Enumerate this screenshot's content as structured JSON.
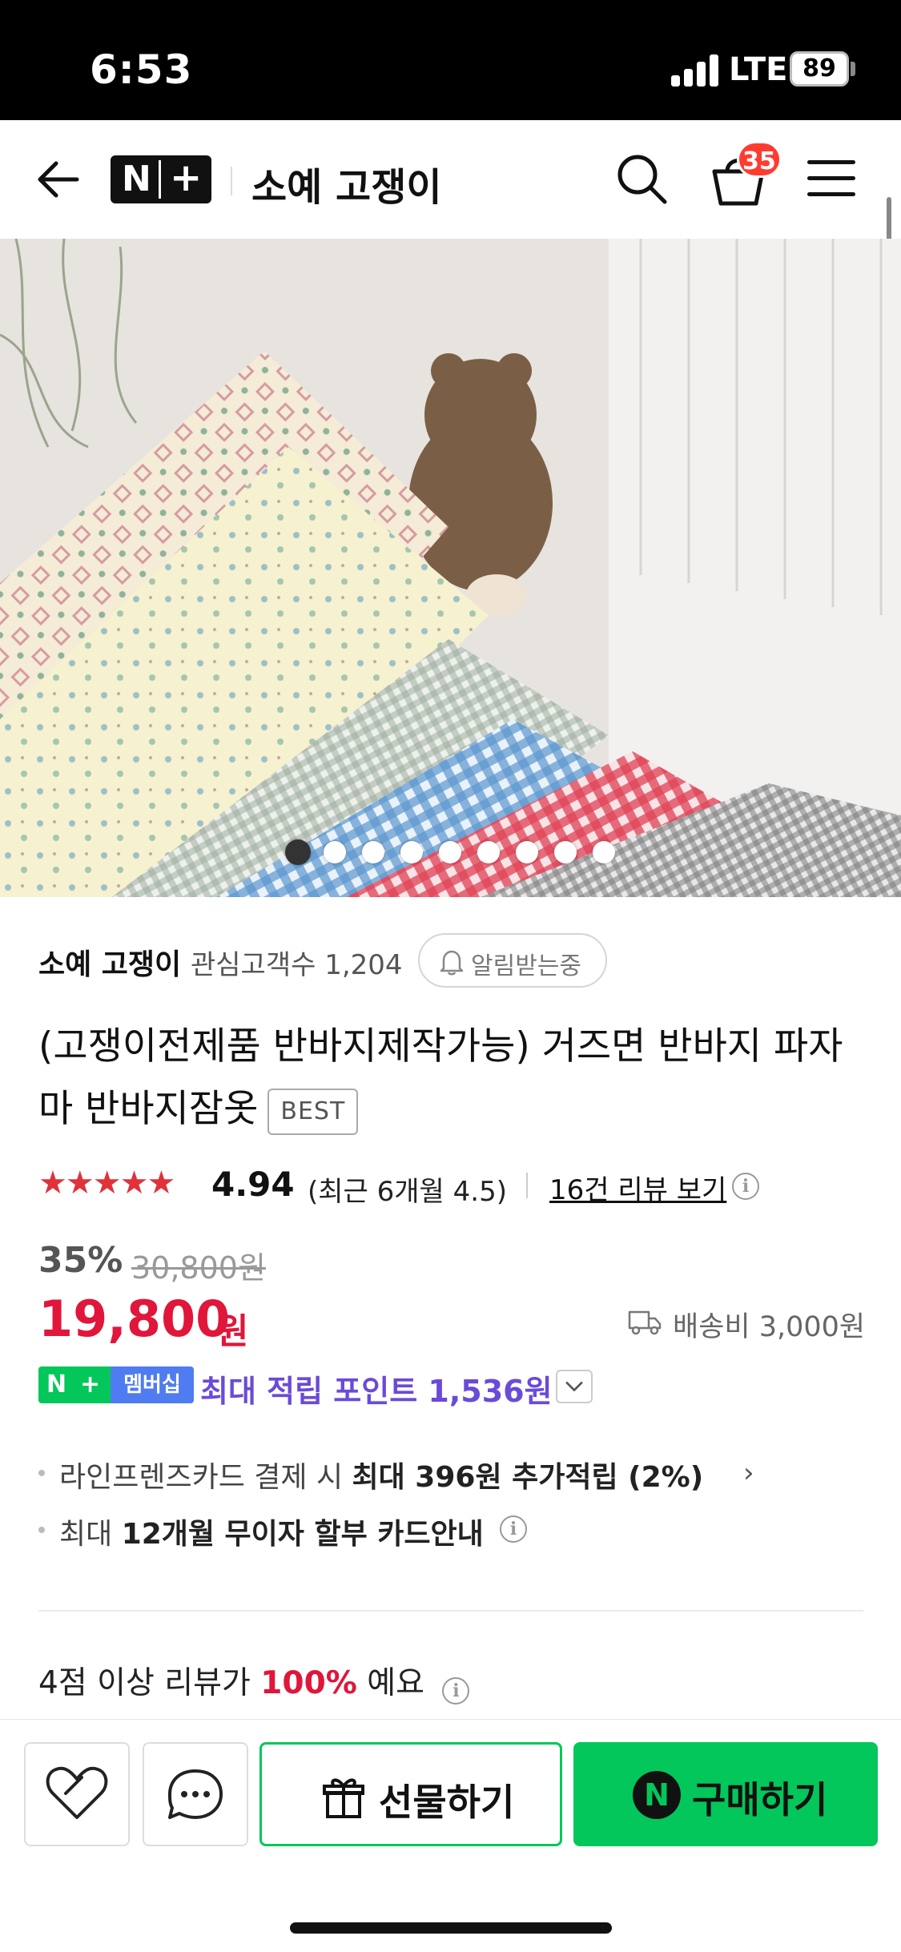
{
  "status_bar": {
    "time": "6:53",
    "network": "LTE",
    "battery": "89"
  },
  "header": {
    "brand_n": "N",
    "brand_plus": "+",
    "store_name": "소예 고쟁이",
    "cart_count": "35"
  },
  "gallery": {
    "total_images": 9,
    "current_index": 1
  },
  "product": {
    "store_name": "소예 고쟁이",
    "followers": "관심고객수 1,204",
    "alarm_label": "알림받는중",
    "title": "(고쟁이전제품 반바지제작가능) 거즈면 반바지 파자마 반바지잠옷",
    "badge": "BEST",
    "stars": "★★★★★",
    "rating": "4.94",
    "recent_rating": "(최근 6개월 4.5)",
    "reviews_link": "16건 리뷰 보기",
    "discount": "35%",
    "original_price": "30,800원",
    "price": "19,800",
    "price_unit": "원",
    "shipping": "배송비 3,000원",
    "membership_label": "멤버십",
    "points": "최대 적립 포인트 1,536원",
    "benefits": [
      {
        "prefix": "라인프렌즈카드 결제 시 ",
        "strong": "최대 396원 추가적립 (2%)"
      },
      {
        "prefix": "최대 ",
        "strong": "12개월 무이자 할부 카드안내"
      }
    ],
    "review_summary_prefix": "4점 이상 리뷰가 ",
    "review_summary_value": "100%",
    "review_summary_suffix": " 예요"
  },
  "actions": {
    "gift_label": "선물하기",
    "buy_label": "구매하기",
    "buy_logo": "N"
  },
  "colors": {
    "accent_green": "#03c75a",
    "price_red": "#e0163a",
    "points_purple": "#6a4bd8",
    "badge_red": "#ff3b30"
  }
}
